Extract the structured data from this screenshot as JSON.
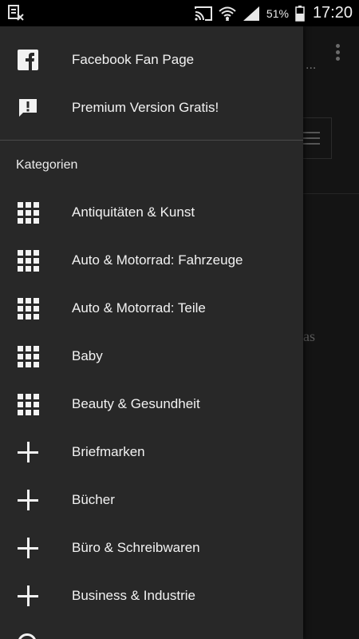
{
  "status_bar": {
    "battery_percent": "51%",
    "time": "17:20",
    "icons": [
      "notification-app-icon",
      "cast-icon",
      "wifi-icon",
      "signal-icon",
      "battery-icon"
    ]
  },
  "background": {
    "truncated_text": "...",
    "fragment_text": "as"
  },
  "drawer": {
    "top_items": [
      {
        "label": "Facebook Fan Page",
        "icon": "facebook-icon"
      },
      {
        "label": "Premium Version Gratis!",
        "icon": "feedback-icon"
      }
    ],
    "section_title": "Kategorien",
    "categories": [
      {
        "label": "Antiquitäten & Kunst",
        "icon": "grid-icon"
      },
      {
        "label": "Auto & Motorrad: Fahrzeuge",
        "icon": "grid-icon"
      },
      {
        "label": "Auto & Motorrad: Teile",
        "icon": "grid-icon"
      },
      {
        "label": "Baby",
        "icon": "grid-icon"
      },
      {
        "label": "Beauty & Gesundheit",
        "icon": "grid-icon"
      },
      {
        "label": "Briefmarken",
        "icon": "plus-icon"
      },
      {
        "label": "Bücher",
        "icon": "plus-icon"
      },
      {
        "label": "Büro & Schreibwaren",
        "icon": "plus-icon"
      },
      {
        "label": "Business & Industrie",
        "icon": "plus-icon"
      }
    ]
  }
}
